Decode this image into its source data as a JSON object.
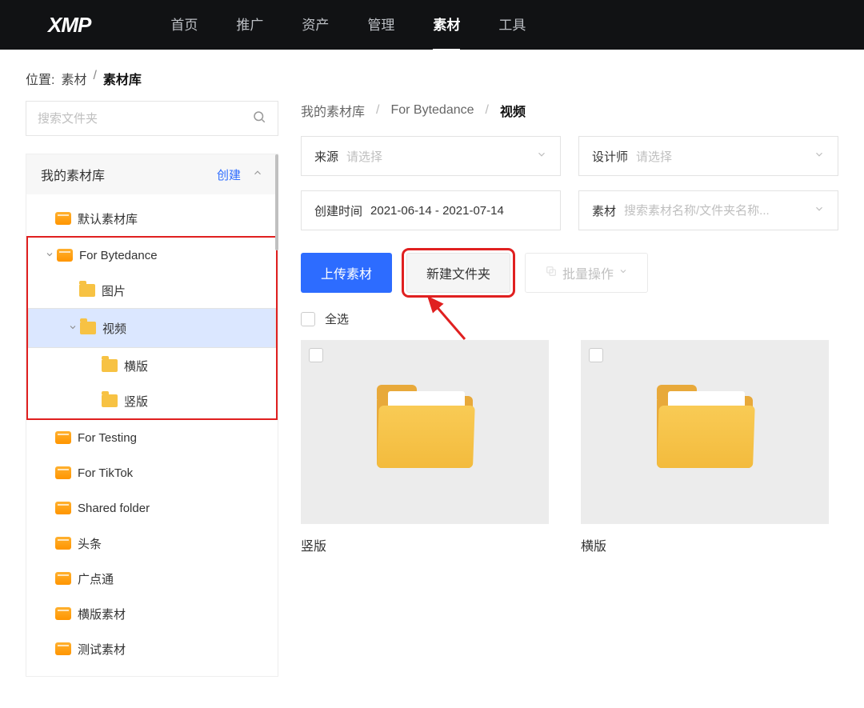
{
  "logo": "XMP",
  "nav": [
    "首页",
    "推广",
    "资产",
    "管理",
    "素材",
    "工具"
  ],
  "nav_active": 4,
  "crumb": {
    "prefix": "位置:",
    "a": "素材",
    "b": "素材库"
  },
  "sidebar": {
    "search_ph": "搜索文件夹",
    "root_title": "我的素材库",
    "create": "创建",
    "tree": [
      {
        "label": "默认素材库",
        "depth": 1,
        "icon": "lib"
      },
      {
        "label": "For Bytedance",
        "depth": 1,
        "icon": "lib",
        "expanded": true,
        "red_start": true
      },
      {
        "label": "图片",
        "depth": 2,
        "icon": "folder"
      },
      {
        "label": "视频",
        "depth": 2,
        "icon": "folder",
        "expanded": true,
        "selected": true
      },
      {
        "label": "横版",
        "depth": 3,
        "icon": "folder"
      },
      {
        "label": "竖版",
        "depth": 3,
        "icon": "folder",
        "red_end": true
      },
      {
        "label": "For Testing",
        "depth": 1,
        "icon": "lib"
      },
      {
        "label": "For TikTok",
        "depth": 1,
        "icon": "lib"
      },
      {
        "label": "Shared folder",
        "depth": 1,
        "icon": "lib"
      },
      {
        "label": "头条",
        "depth": 1,
        "icon": "lib"
      },
      {
        "label": "广点通",
        "depth": 1,
        "icon": "lib"
      },
      {
        "label": "横版素材",
        "depth": 1,
        "icon": "lib"
      },
      {
        "label": "测试素材",
        "depth": 1,
        "icon": "lib"
      }
    ]
  },
  "main": {
    "path": [
      "我的素材库",
      "For Bytedance",
      "视频"
    ],
    "filters": {
      "source_label": "来源",
      "source_ph": "请选择",
      "designer_label": "设计师",
      "designer_ph": "请选择",
      "created_label": "创建时间",
      "created_value": "2021-06-14 - 2021-07-14",
      "material_label": "素材",
      "material_ph": "搜索素材名称/文件夹名称..."
    },
    "buttons": {
      "upload": "上传素材",
      "newfolder": "新建文件夹",
      "batch": "批量操作"
    },
    "select_all": "全选",
    "cards": [
      {
        "name": "竖版"
      },
      {
        "name": "横版"
      }
    ]
  }
}
